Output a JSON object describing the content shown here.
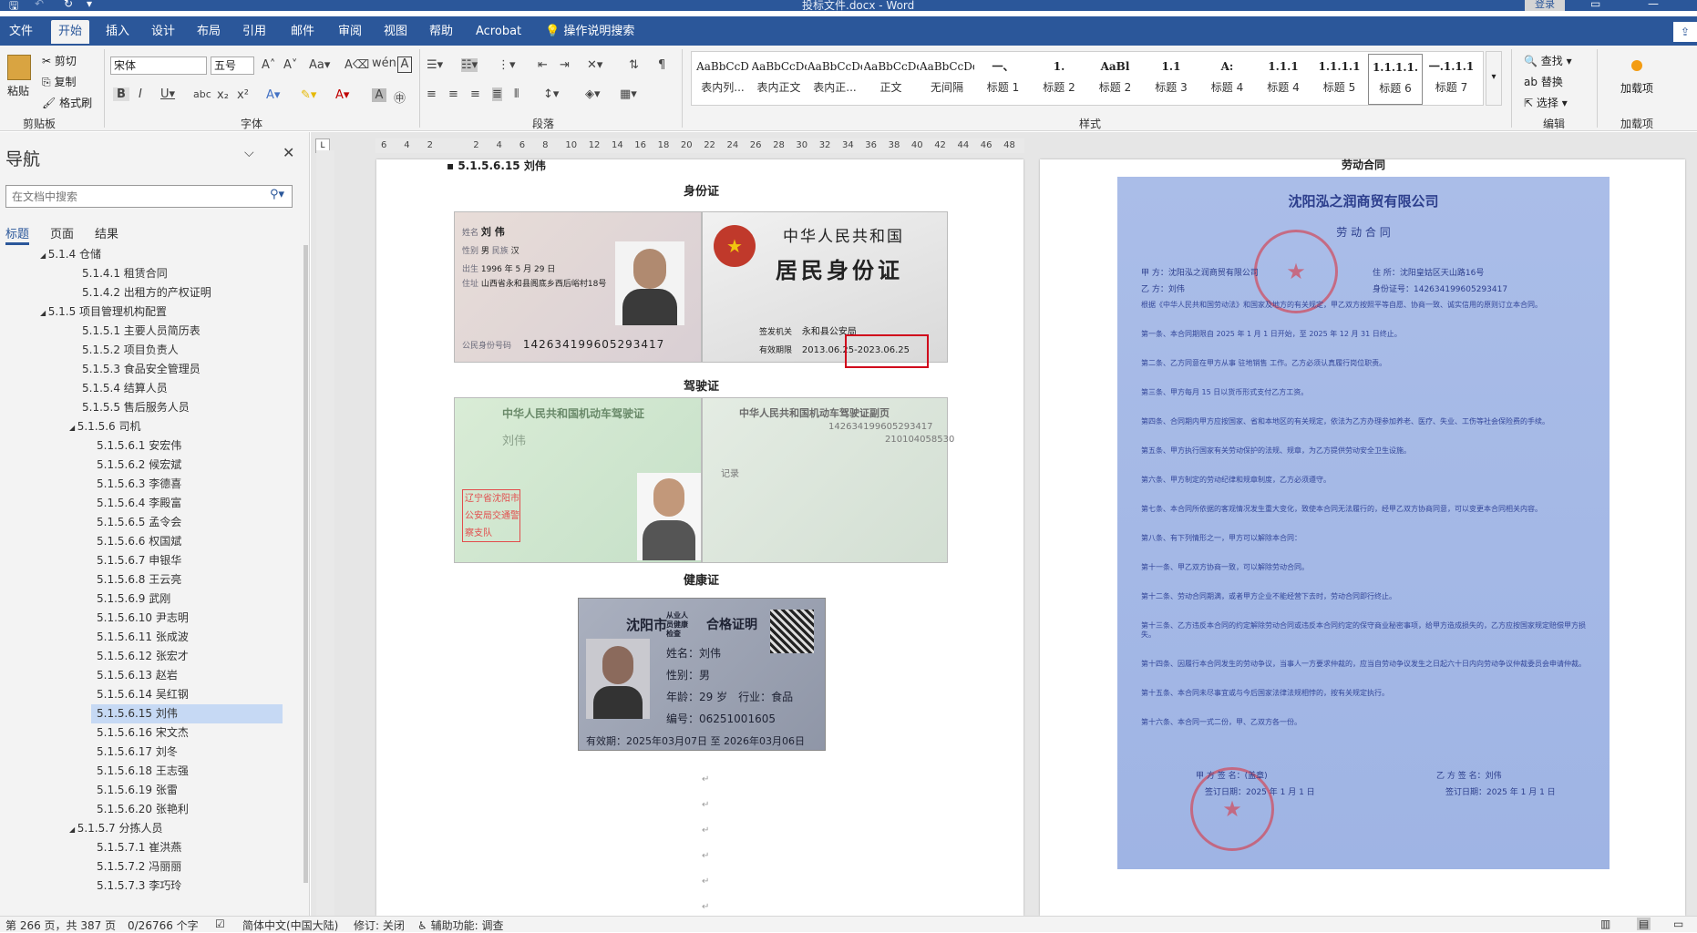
{
  "window": {
    "title": "投标文件.docx - Word",
    "login": "登录"
  },
  "tabs": [
    "文件",
    "开始",
    "插入",
    "设计",
    "布局",
    "引用",
    "邮件",
    "审阅",
    "视图",
    "帮助",
    "Acrobat"
  ],
  "tell_me": "操作说明搜索",
  "clipboard": {
    "paste": "粘贴",
    "cut": "剪切",
    "copy": "复制",
    "format_painter": "格式刷",
    "label": "剪贴板"
  },
  "font": {
    "name": "宋体",
    "size": "五号",
    "label": "字体"
  },
  "paragraph": {
    "label": "段落"
  },
  "styles": {
    "label": "样式",
    "items": [
      {
        "preview": "AaBbCcD",
        "name": "表内列..."
      },
      {
        "preview": "AaBbCcDdI",
        "name": "表内正文"
      },
      {
        "preview": "AaBbCcDdI",
        "name": "表内正..."
      },
      {
        "preview": "AaBbCcDdI",
        "name": "正文"
      },
      {
        "preview": "AaBbCcDdI",
        "name": "无间隔"
      },
      {
        "preview": "一、",
        "name": "标题 1"
      },
      {
        "preview": "1.",
        "name": "标题 2"
      },
      {
        "preview": "AaBl",
        "name": "标题 2"
      },
      {
        "preview": "1.1",
        "name": "标题 3"
      },
      {
        "preview": "A:",
        "name": "标题 4"
      },
      {
        "preview": "1.1.1",
        "name": "标题 4"
      },
      {
        "preview": "1.1.1.1",
        "name": "标题 5"
      },
      {
        "preview": "1.1.1.1.",
        "name": "标题 6"
      },
      {
        "preview": "一.1.1.1",
        "name": "标题 7"
      }
    ]
  },
  "editing": {
    "find": "查找",
    "replace": "替换",
    "select": "选择",
    "label": "编辑"
  },
  "addins": {
    "label": "加载项",
    "button": "加载项"
  },
  "nav": {
    "title": "导航",
    "search_placeholder": "在文档中搜索",
    "tabs": [
      "标题",
      "页面",
      "结果"
    ],
    "items": [
      {
        "text": "5.1.4 仓储",
        "level": 1
      },
      {
        "text": "5.1.4.1 租赁合同",
        "level": 2
      },
      {
        "text": "5.1.4.2 出租方的产权证明",
        "level": 2
      },
      {
        "text": "5.1.5 项目管理机构配置",
        "level": 1
      },
      {
        "text": "5.1.5.1 主要人员简历表",
        "level": 2
      },
      {
        "text": "5.1.5.2 项目负责人",
        "level": 2
      },
      {
        "text": "5.1.5.3 食品安全管理员",
        "level": 2
      },
      {
        "text": "5.1.5.4 结算人员",
        "level": 2
      },
      {
        "text": "5.1.5.5 售后服务人员",
        "level": 2
      },
      {
        "text": "5.1.5.6 司机",
        "level": 2
      },
      {
        "text": "5.1.5.6.1 安宏伟",
        "level": 3
      },
      {
        "text": "5.1.5.6.2 候宏斌",
        "level": 3
      },
      {
        "text": "5.1.5.6.3 李德喜",
        "level": 3
      },
      {
        "text": "5.1.5.6.4 李殿富",
        "level": 3
      },
      {
        "text": "5.1.5.6.5 孟令会",
        "level": 3
      },
      {
        "text": "5.1.5.6.6 权国斌",
        "level": 3
      },
      {
        "text": "5.1.5.6.7 申银华",
        "level": 3
      },
      {
        "text": "5.1.5.6.8 王云亮",
        "level": 3
      },
      {
        "text": "5.1.5.6.9 武刚",
        "level": 3
      },
      {
        "text": "5.1.5.6.10 尹志明",
        "level": 3
      },
      {
        "text": "5.1.5.6.11 张成波",
        "level": 3
      },
      {
        "text": "5.1.5.6.12 张宏才",
        "level": 3
      },
      {
        "text": "5.1.5.6.13 赵岩",
        "level": 3
      },
      {
        "text": "5.1.5.6.14 吴红钢",
        "level": 3
      },
      {
        "text": "5.1.5.6.15 刘伟",
        "level": 3
      },
      {
        "text": "5.1.5.6.16 宋文杰",
        "level": 3
      },
      {
        "text": "5.1.5.6.17 刘冬",
        "level": 3
      },
      {
        "text": "5.1.5.6.18 王志强",
        "level": 3
      },
      {
        "text": "5.1.5.6.19 张雷",
        "level": 3
      },
      {
        "text": "5.1.5.6.20 张艳利",
        "level": 3
      },
      {
        "text": "5.1.5.7 分拣人员",
        "level": 2
      },
      {
        "text": "5.1.5.7.1 崔洪燕",
        "level": 3
      },
      {
        "text": "5.1.5.7.2 冯丽丽",
        "level": 3
      },
      {
        "text": "5.1.5.7.3 李巧玲",
        "level": 3
      }
    ],
    "selected_index": 24
  },
  "ruler": [
    "6",
    "4",
    "2",
    "",
    "2",
    "4",
    "6",
    "8",
    "10",
    "12",
    "14",
    "16",
    "18",
    "20",
    "22",
    "24",
    "26",
    "28",
    "30",
    "32",
    "34",
    "36",
    "38",
    "40",
    "42",
    "44",
    "46",
    "48"
  ],
  "page1": {
    "heading": "5.1.5.6.15 刘伟",
    "cap_id": "身份证",
    "cap_drive": "驾驶证",
    "cap_health": "健康证",
    "id_card": {
      "name_label": "姓名",
      "name": "刘 伟",
      "sex_label": "性别",
      "sex": "男",
      "nation_label": "民族",
      "nation": "汉",
      "birth_label": "出生",
      "birth": "1996 年 5 月 29 日",
      "addr_label": "住址",
      "addr": "山西省永和县阁底乡西后峪村18号",
      "idno_label": "公民身份号码",
      "idno": "142634199605293417",
      "country": "中华人民共和国",
      "title": "居民身份证",
      "issuer_label": "签发机关",
      "issuer": "永和县公安局",
      "valid_label": "有效期限",
      "valid": "2013.06.25-2023.06.25"
    },
    "license": {
      "title": "中华人民共和国机动车驾驶证",
      "title2": "中华人民共和国机动车驾驶证副页",
      "num": "142634199605293417",
      "file": "210104058530",
      "name": "刘伟",
      "seal": "辽宁省沈阳市公安局交通警察支队",
      "record": "记录"
    },
    "health": {
      "city": "沈阳市",
      "sub": "从业人员健康检查",
      "title": "合格证明",
      "name": "姓名：刘伟",
      "sex": "性别：男",
      "age": "年龄：29 岁",
      "trade": "行业：食品",
      "no": "编号：06251001605",
      "valid": "有效期：2025年03月07日 至 2026年03月06日"
    }
  },
  "page2": {
    "heading": "劳动合同",
    "company": "沈阳泓之润商贸有限公司",
    "doc_title": "劳 动 合 同",
    "partyA": "甲 方：沈阳泓之润商贸有限公司",
    "addr": "住 所：沈阳皇姑区天山路16号",
    "partyB": "乙 方：刘伟",
    "id": "身份证号：142634199605293417",
    "clauses": [
      "根据《中华人民共和国劳动法》和国家及地方的有关规定，甲乙双方按照平等自愿、协商一致、诚实信用的原则订立本合同。",
      "第一条、本合同期限自 2025 年 1 月 1 日开始，至 2025 年 12 月 31 日终止。",
      "第二条、乙方同意在甲方从事 驻地销售 工作。乙方必须认真履行岗位职责。",
      "第三条、甲方每月 15 日以货币形式支付乙方工资。",
      "第四条、合同期内甲方应按国家、省和本地区的有关规定，依法为乙方办理参加养老、医疗、失业、工伤等社会保险费的手续。",
      "第五条、甲方执行国家有关劳动保护的法规、规章，为乙方提供劳动安全卫生设施。",
      "第六条、甲方制定的劳动纪律和规章制度，乙方必须遵守。",
      "第七条、本合同所依据的客观情况发生重大变化，致使本合同无法履行的，经甲乙双方协商同意，可以变更本合同相关内容。",
      "第八条、有下列情形之一，甲方可以解除本合同：",
      "第十一条、甲乙双方协商一致，可以解除劳动合同。",
      "第十二条、劳动合同期满，或者甲方企业不能经营下去时，劳动合同即行终止。",
      "第十三条、乙方违反本合同的约定解除劳动合同或违反本合同约定的保守商业秘密事项，给甲方造成损失的，乙方应按国家规定赔偿甲方损失。",
      "第十四条、因履行本合同发生的劳动争议，当事人一方要求仲裁的，应当自劳动争议发生之日起六十日内向劳动争议仲裁委员会申请仲裁。",
      "第十五条、本合同未尽事宜或与今后国家法律法规相悖的，按有关规定执行。",
      "第十六条、本合同一式二份，甲、乙双方各一份。"
    ],
    "signA": "甲 方 签 名：(盖章)",
    "signB": "乙 方 签 名：刘伟",
    "dateA": "签订日期：2025 年 1 月 1 日",
    "dateB": "签订日期：2025 年 1 月 1 日"
  },
  "status": {
    "page": "第 266 页，共 387 页",
    "words": "0/26766 个字",
    "lang": "简体中文(中国大陆)",
    "track": "修订: 关闭",
    "access": "辅助功能: 调查"
  },
  "colors": {
    "accent": "#2b579a",
    "highlight": "#c6d9f4",
    "redbox": "#d0021b"
  }
}
